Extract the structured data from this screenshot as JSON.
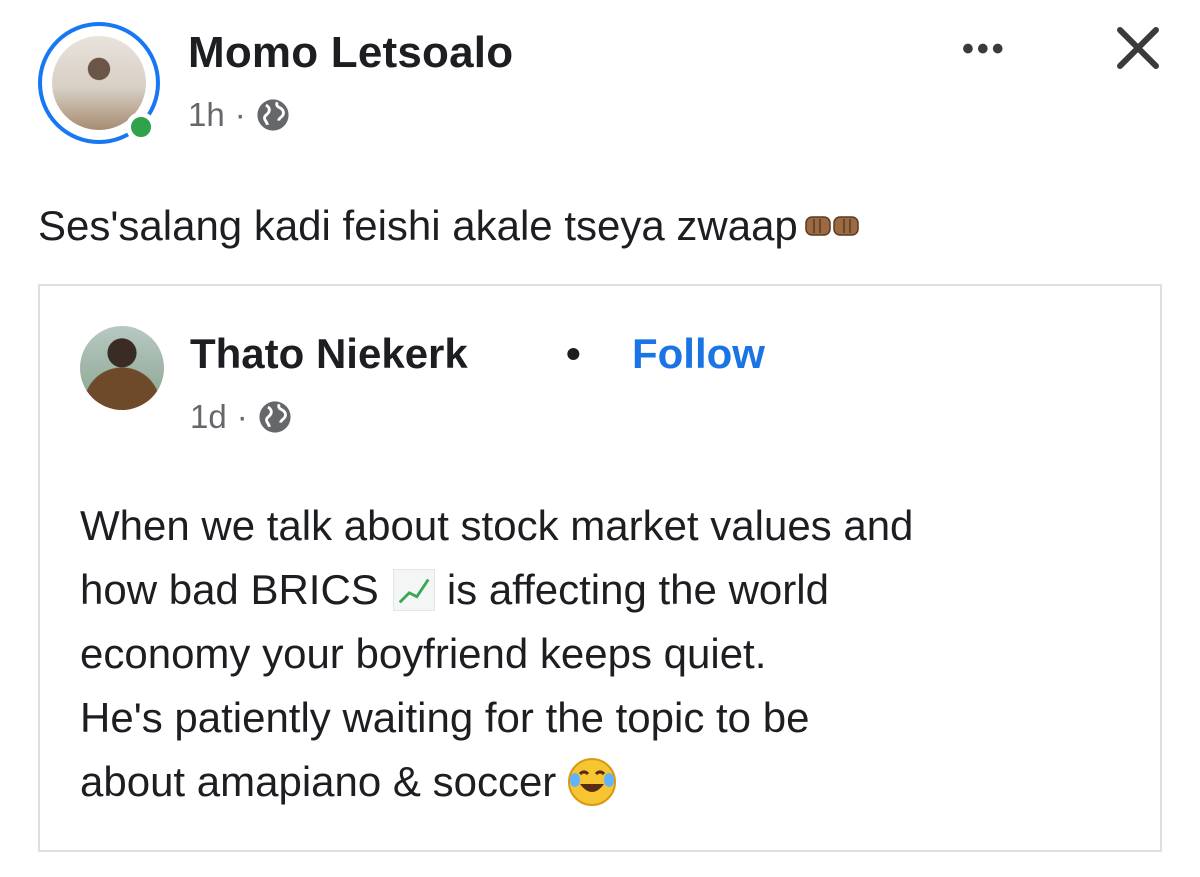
{
  "post": {
    "author": "Momo Letsoalo",
    "time": "1h",
    "separator": "·",
    "more_label": "•••",
    "status": "Ses'salang kadi feishi akale tseya zwaap",
    "status_emoji": "fist-bump-icon"
  },
  "shared": {
    "author": "Thato Niekerk",
    "separator": "•",
    "follow_label": "Follow",
    "time": "1d",
    "meta_separator": "·",
    "lines": {
      "l1": "When we talk about stock market values and",
      "l2a": "how bad BRICS",
      "l2b": "is affecting the world",
      "l3": "economy your boyfriend keeps quiet.",
      "l4": "He's patiently waiting for the topic to be",
      "l5": "about amapiano & soccer"
    }
  },
  "colors": {
    "link": "#1b74e4",
    "online": "#31a24c",
    "ring": "#1877f2",
    "text": "#1c1e21",
    "muted": "#65676b"
  }
}
